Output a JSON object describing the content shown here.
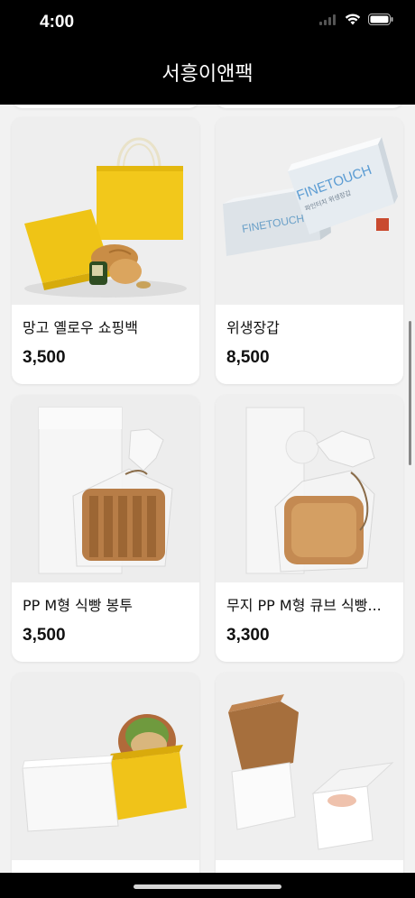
{
  "status_bar": {
    "time": "4:00"
  },
  "nav": {
    "title": "서흥이앤팩"
  },
  "products": [
    {
      "name": "망고 옐로우 쇼핑백",
      "price": "3,500"
    },
    {
      "name": "위생장갑",
      "price": "8,500"
    },
    {
      "name": "PP M형 식빵 봉투",
      "price": "3,500"
    },
    {
      "name": "무지 PP M형 큐브 식빵...",
      "price": "3,300"
    },
    {
      "name": "",
      "price": ""
    },
    {
      "name": "",
      "price": ""
    }
  ],
  "images": {
    "gloves_brand": "FINETOUCH",
    "gloves_sub": "파인터치 위생장갑"
  },
  "colors": {
    "bar_background": "#000000",
    "page_background": "#f2f2f2",
    "card_background": "#ffffff",
    "bag_yellow": "#f2c81b"
  }
}
